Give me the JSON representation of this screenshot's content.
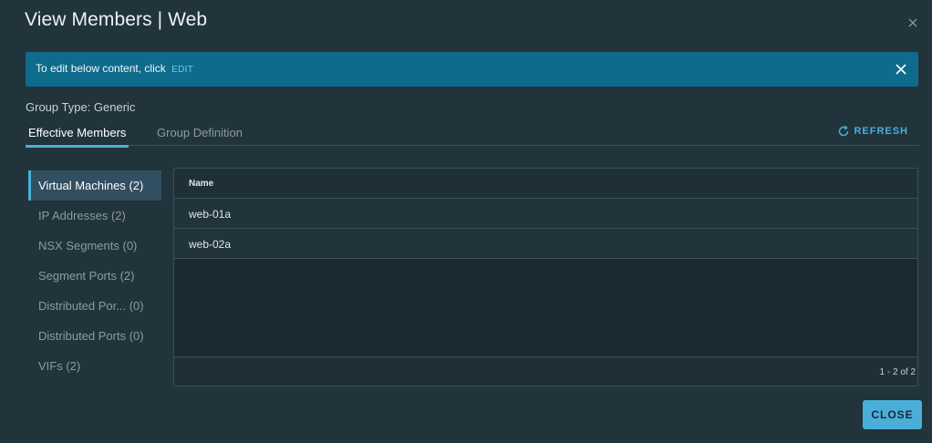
{
  "modal": {
    "title": "View Members | Web"
  },
  "alert": {
    "text": "To edit below content, click",
    "link": "EDIT"
  },
  "group_type": "Group Type: Generic",
  "tabs": [
    {
      "label": "Effective Members",
      "active": true
    },
    {
      "label": "Group Definition",
      "active": false
    }
  ],
  "refresh_label": "REFRESH",
  "member_types": [
    {
      "label": "Virtual Machines (2)",
      "active": true
    },
    {
      "label": "IP Addresses (2)",
      "active": false
    },
    {
      "label": "NSX Segments (0)",
      "active": false
    },
    {
      "label": "Segment Ports (2)",
      "active": false
    },
    {
      "label": "Distributed Por...  (0)",
      "active": false
    },
    {
      "label": "Distributed Ports (0)",
      "active": false
    },
    {
      "label": "VIFs (2)",
      "active": false
    }
  ],
  "grid": {
    "column": "Name",
    "rows": [
      "web-01a",
      "web-02a"
    ],
    "footer": "1 - 2 of 2"
  },
  "close_label": "CLOSE",
  "colors": {
    "background": "#21333b",
    "accent": "#49afd9",
    "alert": "#0e6b8c"
  },
  "icons": [
    "close-icon",
    "alert-close-icon",
    "refresh-icon"
  ]
}
